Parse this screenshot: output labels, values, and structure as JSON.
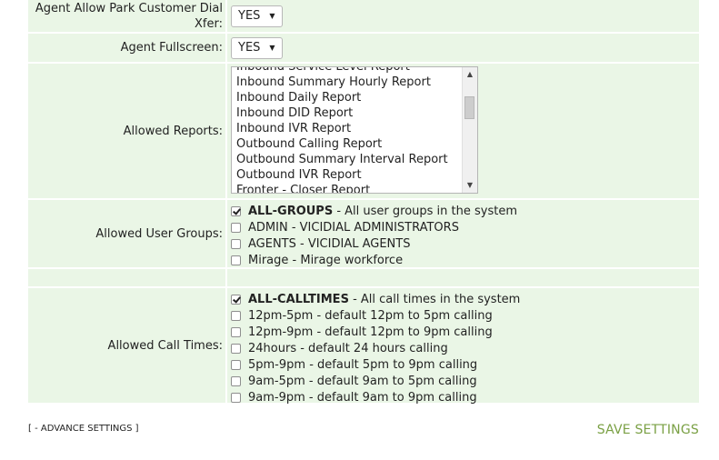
{
  "fields": {
    "park_xfer": {
      "label": "Agent Allow Park Customer Dial Xfer:",
      "value": "YES"
    },
    "fullscreen": {
      "label": "Agent Fullscreen:",
      "value": "YES"
    },
    "allowed_reports": {
      "label": "Allowed Reports:",
      "options": [
        "Inbound Service Level Report",
        "Inbound Summary Hourly Report",
        "Inbound Daily Report",
        "Inbound DID Report",
        "Inbound IVR Report",
        "Outbound Calling Report",
        "Outbound Summary Interval Report",
        "Outbound IVR Report",
        "Fronter - Closer Report"
      ]
    },
    "allowed_user_groups": {
      "label": "Allowed User Groups:",
      "items": [
        {
          "code": "ALL-GROUPS",
          "desc": " - All user groups in the system",
          "checked": true
        },
        {
          "code": "ADMIN",
          "desc": " - VICIDIAL ADMINISTRATORS",
          "checked": false
        },
        {
          "code": "AGENTS",
          "desc": " - VICIDIAL AGENTS",
          "checked": false
        },
        {
          "code": "Mirage",
          "desc": " - Mirage workforce",
          "checked": false
        }
      ]
    },
    "allowed_call_times": {
      "label": "Allowed Call Times:",
      "items": [
        {
          "code": "ALL-CALLTIMES",
          "desc": " - All call times in the system",
          "checked": true
        },
        {
          "code": "12pm-5pm",
          "desc": " - default 12pm to 5pm calling",
          "checked": false
        },
        {
          "code": "12pm-9pm",
          "desc": " - default 12pm to 9pm calling",
          "checked": false
        },
        {
          "code": "24hours",
          "desc": " - default 24 hours calling",
          "checked": false
        },
        {
          "code": "5pm-9pm",
          "desc": " - default 5pm to 9pm calling",
          "checked": false
        },
        {
          "code": "9am-5pm",
          "desc": " - default 9am to 5pm calling",
          "checked": false
        },
        {
          "code": "9am-9pm",
          "desc": " - default 9am to 9pm calling",
          "checked": false
        }
      ]
    }
  },
  "footer": {
    "advance_settings": "[ - ADVANCE SETTINGS ]",
    "save": "SAVE SETTINGS"
  }
}
